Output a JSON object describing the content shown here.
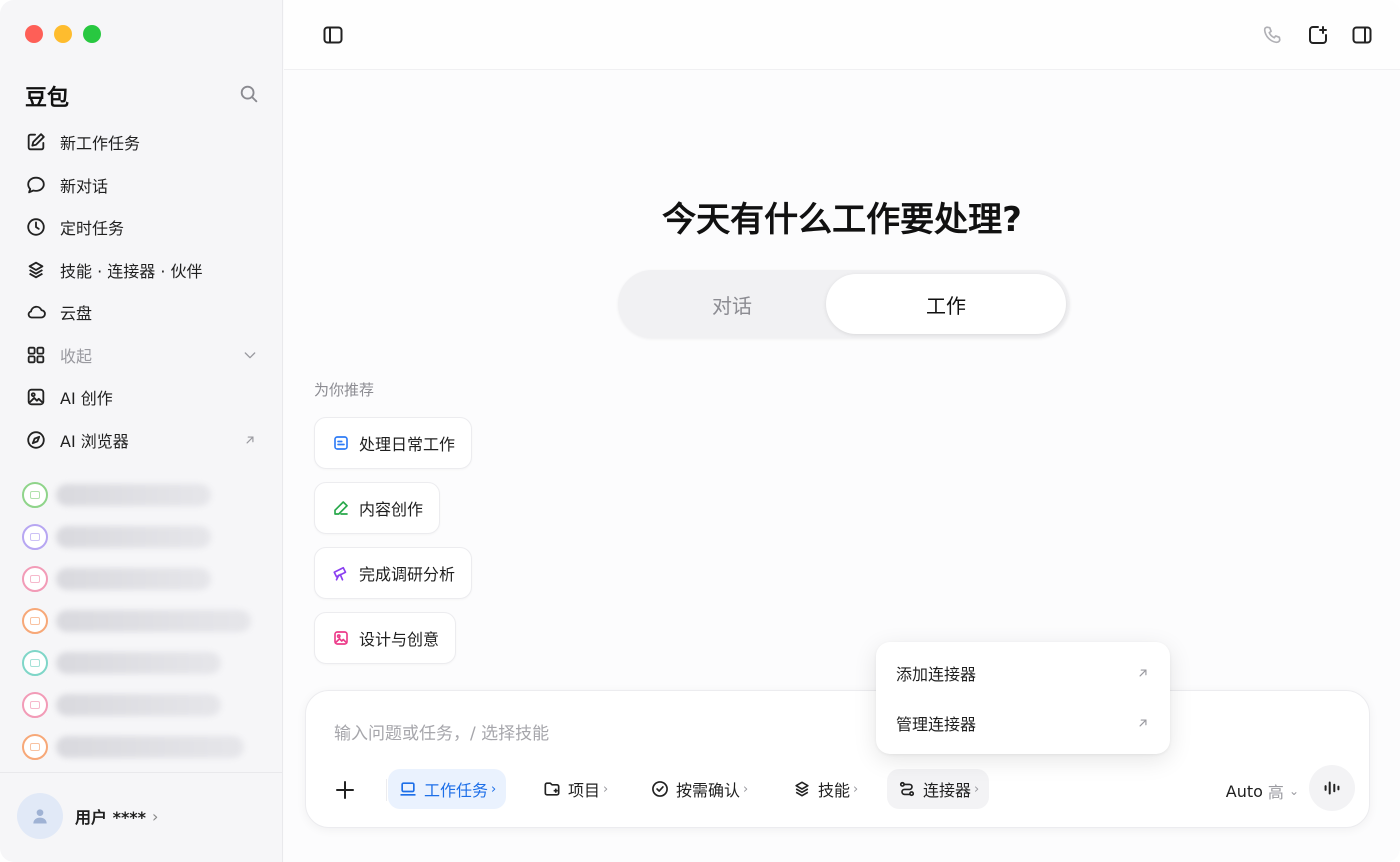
{
  "sidebar": {
    "brand": "豆包",
    "items": [
      {
        "label": "新工作任务",
        "icon": "edit-icon"
      },
      {
        "label": "新对话",
        "icon": "chat-bubble-icon"
      },
      {
        "label": "定时任务",
        "icon": "clock-icon"
      },
      {
        "label": "技能 · 连接器 · 伙伴",
        "icon": "layers-icon"
      },
      {
        "label": "云盘",
        "icon": "cloud-icon"
      },
      {
        "label": "收起",
        "icon": "grid-icon"
      },
      {
        "label": "AI 创作",
        "icon": "image-icon"
      },
      {
        "label": "AI 浏览器",
        "icon": "compass-icon"
      }
    ],
    "history_colors": [
      "#8fd48a",
      "#b7a6f2",
      "#f29bb7",
      "#f7a878",
      "#7fd6c8",
      "#f29bb7",
      "#f7a878"
    ],
    "user": {
      "name": "用户 ****"
    }
  },
  "main": {
    "headline": "今天有什么工作要处理?",
    "mode_toggle": {
      "left": "对话",
      "right": "工作"
    },
    "recommend_label": "为你推荐",
    "chips": [
      {
        "label": "处理日常工作",
        "icon": "doc-icon",
        "color": "#2f7cf6"
      },
      {
        "label": "内容创作",
        "icon": "pen-icon",
        "color": "#27a84a"
      },
      {
        "label": "完成调研分析",
        "icon": "telescope-icon",
        "color": "#8a3ff0"
      },
      {
        "label": "设计与创意",
        "icon": "image-icon",
        "color": "#ec3c8a"
      }
    ],
    "dropdown": {
      "items": [
        {
          "label": "添加连接器"
        },
        {
          "label": "管理连接器"
        }
      ]
    },
    "composer": {
      "placeholder": "输入问题或任务，/ 选择技能",
      "tools": [
        {
          "label": "工作任务",
          "icon": "laptop-icon"
        },
        {
          "label": "项目",
          "icon": "folder-icon"
        },
        {
          "label": "按需确认",
          "icon": "check-circle-icon"
        },
        {
          "label": "技能",
          "icon": "layers-icon"
        },
        {
          "label": "连接器",
          "icon": "connector-icon"
        }
      ],
      "model": "Auto",
      "level": "高"
    }
  },
  "colors": {
    "accent": "#1d6fe8",
    "accent_bg": "#eaf2fe"
  }
}
